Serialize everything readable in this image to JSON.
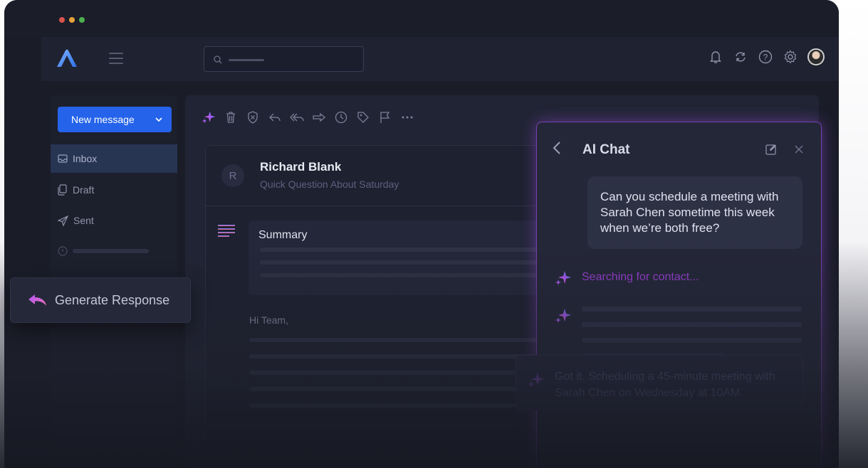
{
  "app": {
    "accent": "#2563eb",
    "ai_accent": "#a855f7"
  },
  "sidebar": {
    "new_message_label": "New message",
    "items": [
      {
        "label": "Inbox",
        "icon": "inbox-icon"
      },
      {
        "label": "Draft",
        "icon": "draft-icon"
      },
      {
        "label": "Sent",
        "icon": "sent-icon"
      }
    ]
  },
  "email": {
    "avatar_initial": "R",
    "sender_name": "Richard Blank",
    "subject": "Quick Question About Saturday",
    "summary_title": "Summary",
    "greeting": "Hi Team,"
  },
  "generate": {
    "label": "Generate Response"
  },
  "ai_chat": {
    "title": "AI Chat",
    "user_message": "Can you schedule a meeting with Sarah Chen sometime this week when we’re both free?",
    "status": "Searching for contact...",
    "reply": "Got it. Scheduling a 45-minute meeting with Sarah Chen on Wednesday at 10AM."
  }
}
